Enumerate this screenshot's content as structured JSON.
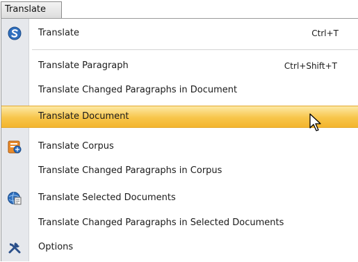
{
  "menu": {
    "title": "Translate",
    "items": [
      {
        "label": "Translate",
        "shortcut": "Ctrl+T",
        "icon": "translate-globe-icon"
      },
      {
        "label": "Translate Paragraph",
        "shortcut": "Ctrl+Shift+T"
      },
      {
        "label": "Translate Changed Paragraphs in Document"
      },
      {
        "label": "Translate Document",
        "highlighted": true
      },
      {
        "label": "Translate Corpus",
        "icon": "corpus-icon"
      },
      {
        "label": "Translate Changed Paragraphs in Corpus"
      },
      {
        "label": "Translate Selected Documents",
        "icon": "documents-globe-icon"
      },
      {
        "label": "Translate Changed Paragraphs in Selected Documents"
      },
      {
        "label": "Options",
        "icon": "tools-icon"
      }
    ]
  },
  "colors": {
    "highlight": "#f7c54a",
    "gutter": "#e6e8ec"
  }
}
